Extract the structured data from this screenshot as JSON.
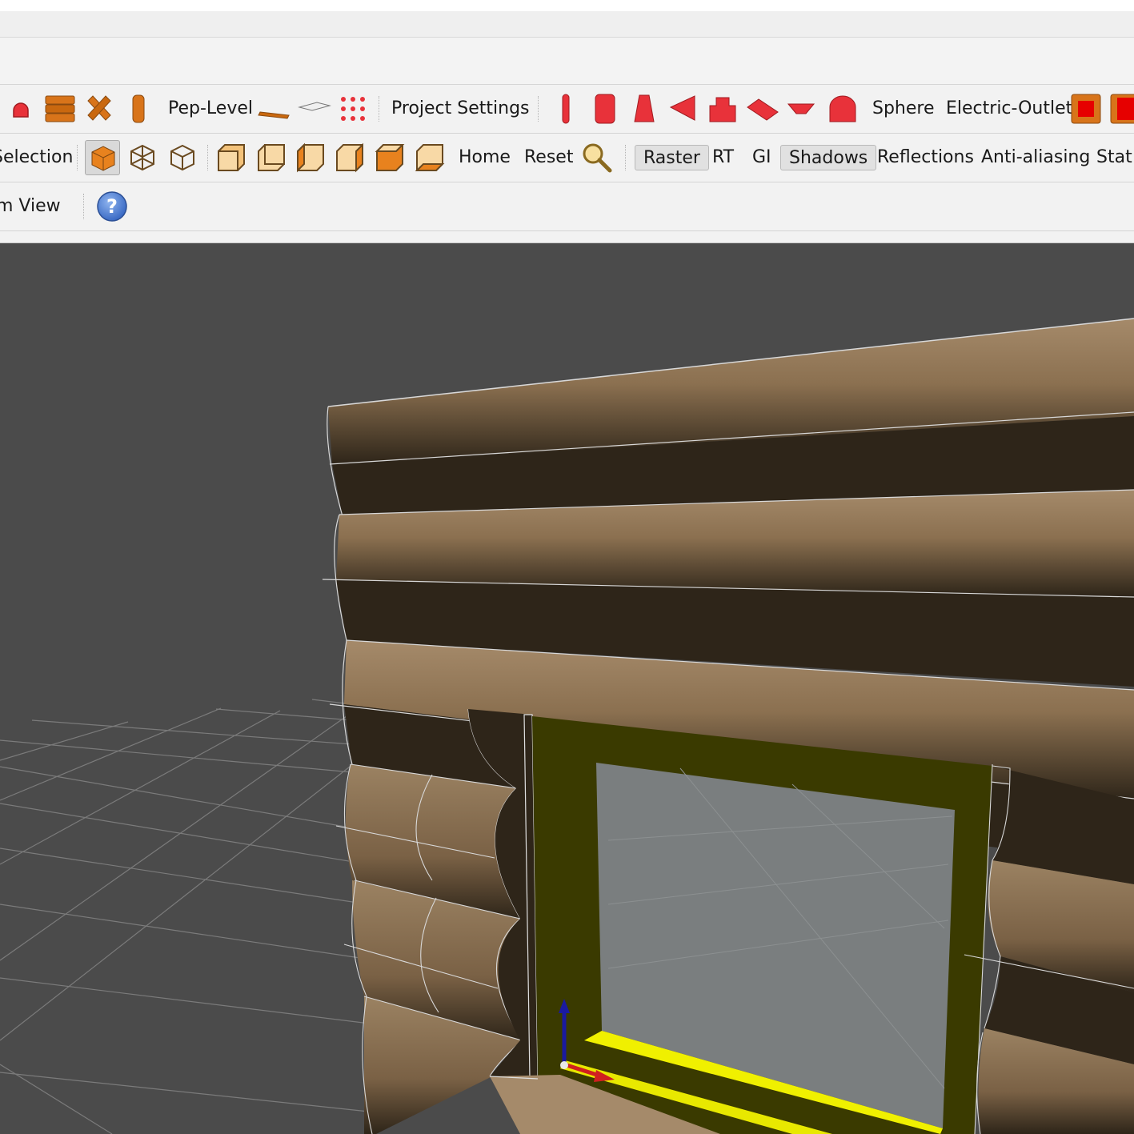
{
  "toolbar1": {
    "pep_level_label": "Pep-Level",
    "project_settings_label": "Project Settings",
    "sphere_label": "Sphere",
    "electric_outlet_label": "Electric-Outlet"
  },
  "toolbar2": {
    "selection_label": "Selection",
    "home_label": "Home",
    "reset_label": "Reset",
    "render_modes": [
      "Raster",
      "RT",
      "GI",
      "Shadows",
      "Reflections",
      "Anti-aliasing",
      "Stat"
    ]
  },
  "toolbar3": {
    "zoom_view_label": "Zoom View"
  },
  "colors": {
    "accent_orange": "#e8821e",
    "accent_red": "#e8323a",
    "log_light": "#a58a6a",
    "log_dark": "#2e2519",
    "window_frame": "#3a3a00",
    "window_glass": "#7a7e7f",
    "sill_highlight": "#f0f000",
    "viewport_bg": "#4b4b4b",
    "help_blue": "#4d7fd0"
  },
  "icons": {
    "toolbar1": [
      "red-dome-icon",
      "wall-stack-icon",
      "cross-beam-icon",
      "post-icon",
      "slab-icon",
      "plate-icon",
      "dot-grid-icon",
      "cylinder-icon",
      "cylinder-red-icon",
      "cone-icon",
      "wedge-icon",
      "step-block-icon",
      "roof-slab-icon",
      "trapezoid-icon",
      "arch-icon",
      "outlet-icon"
    ],
    "toolbar2": [
      "solid-cube-icon",
      "wire-cube-icon",
      "outline-cube-icon",
      "view-front-icon",
      "view-back-icon",
      "view-left-icon",
      "view-right-icon",
      "view-top-icon",
      "view-bottom-icon",
      "zoom-search-icon"
    ],
    "toolbar3": [
      "help-icon"
    ]
  }
}
